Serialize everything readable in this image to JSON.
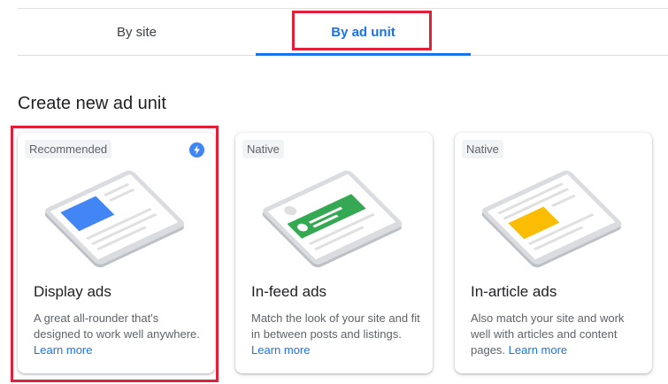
{
  "tabs": [
    {
      "label": "By site",
      "selected": false
    },
    {
      "label": "By ad unit",
      "selected": true
    }
  ],
  "section_title": "Create new ad unit",
  "cards": [
    {
      "badge": "Recommended",
      "icon": "lightning-bolt-icon",
      "title": "Display ads",
      "description": "A great all-rounder that's designed to work well anywhere.",
      "link": "Learn more",
      "accent": "#4285f4"
    },
    {
      "badge": "Native",
      "title": "In-feed ads",
      "description": "Match the look of your site and fit in between posts and listings.",
      "link": "Learn more",
      "accent": "#34a853"
    },
    {
      "badge": "Native",
      "title": "In-article ads",
      "description": "Also match your site and work well with articles and content pages.",
      "link": "Learn more",
      "accent": "#fbbc04"
    }
  ],
  "colors": {
    "brand_blue": "#1a73e8",
    "highlight_red": "#e0213c"
  }
}
